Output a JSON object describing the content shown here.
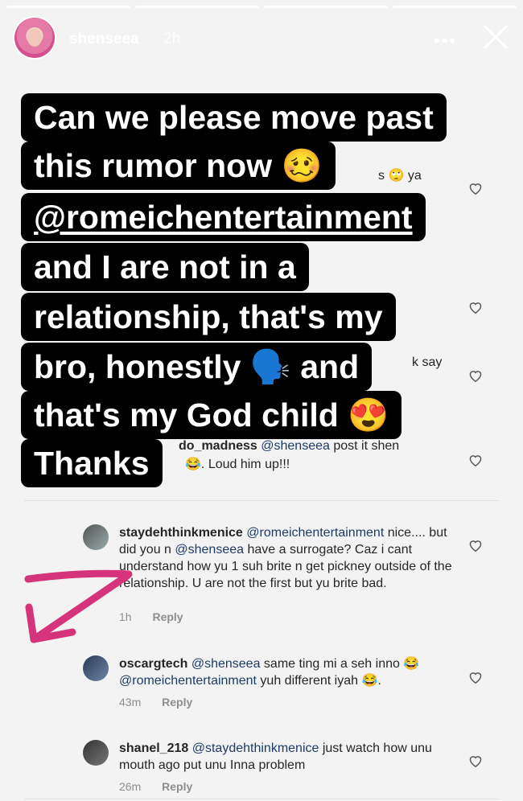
{
  "story": {
    "username": "shenseea",
    "time_ago": "2h",
    "more_label": "•••",
    "progress_segments": 4
  },
  "overlay": {
    "lines": [
      "Can we please move past",
      "this rumor now 🥴",
      "@romeichentertainment",
      "and I are not in a",
      "relationship, that's my",
      "bro, honestly 🗣️ and",
      "that's my God child 😍",
      "Thanks"
    ]
  },
  "fragments": {
    "f1": "s 🙄 ya",
    "f2": "k say",
    "f3_user": "do_madness",
    "f3_mention": "@shenseea",
    "f3_text": " post it shen",
    "f3_line2": "😂. Loud him up!!!"
  },
  "comments": [
    {
      "username": "staydehthinkmenice",
      "mention": "@romeichentertainment",
      "text_line1_after": "",
      "text": "nice.... but did you n @shenseea have a surrogate? Caz i cant understand how yu 1 suh brite n get pickney outside of the relationship. U are not the first but yu brite bad.",
      "part2": "nice.... but did you n ",
      "mention2": "@shenseea",
      "part3": " have a surrogate? Caz i cant understand how yu 1 suh brite n get pickney outside of the relationship. U are not the first but yu brite bad.",
      "time": "1h",
      "reply": "Reply"
    },
    {
      "username": "oscargtech",
      "mention": "@shenseea",
      "part2": " same ting mi a seh inno 😂 ",
      "mention2": "@romeichentertainment",
      "part3": " yuh different iyah 😂.",
      "time": "43m",
      "reply": "Reply"
    },
    {
      "username": "shanel_218",
      "mention": "@staydehthinkmenice",
      "part2": " just watch how unu mouth ago put unu Inna problem",
      "time": "26m",
      "reply": "Reply"
    }
  ],
  "colors": {
    "overlay_bg": "#000000",
    "mention": "#1d3b6a",
    "arrow": "#d6347a"
  },
  "icons": [
    "close-icon",
    "more-icon",
    "heart-icon",
    "arrow-drawing"
  ]
}
